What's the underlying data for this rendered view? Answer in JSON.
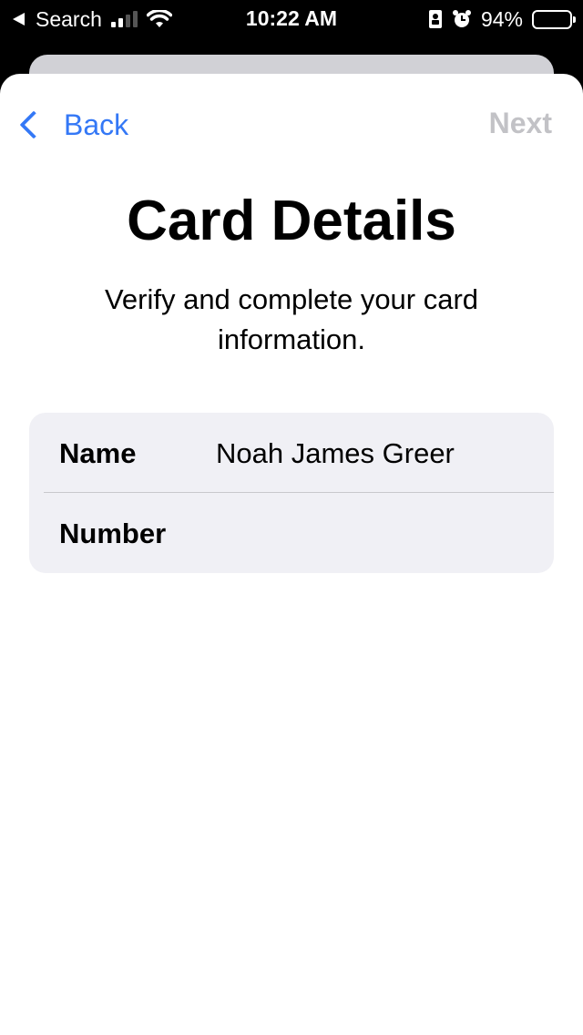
{
  "status_bar": {
    "back_app_label": "Search",
    "time": "10:22 AM",
    "battery_percent": "94%",
    "battery_level": 0.94
  },
  "nav": {
    "back_label": "Back",
    "next_label": "Next"
  },
  "header": {
    "title": "Card Details",
    "subtitle": "Verify and complete your card information."
  },
  "form": {
    "name_label": "Name",
    "name_value": "Noah James Greer",
    "number_label": "Number",
    "number_value": ""
  },
  "colors": {
    "accent": "#3478f6",
    "disabled": "#c2c2c6",
    "card_bg": "#f0f0f5"
  },
  "icons": [
    "back-arrow-icon",
    "cellular-signal-icon",
    "wifi-icon",
    "portrait-lock-icon",
    "alarm-icon",
    "battery-icon",
    "chevron-left-icon"
  ]
}
